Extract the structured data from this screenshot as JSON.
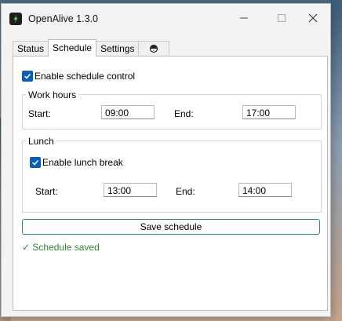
{
  "window": {
    "title": "OpenAlive 1.3.0",
    "controls": [
      "minimize",
      "maximize",
      "close"
    ]
  },
  "tabs": [
    {
      "label": "Status",
      "active": false
    },
    {
      "label": "Schedule",
      "active": true
    },
    {
      "label": "Settings",
      "active": false
    },
    {
      "icon": "palette-icon",
      "active": false
    }
  ],
  "schedule": {
    "enable_label": "Enable schedule control",
    "enabled": true,
    "work_hours": {
      "title": "Work hours",
      "start_label": "Start:",
      "start_value": "09:00",
      "end_label": "End:",
      "end_value": "17:00"
    },
    "lunch": {
      "title": "Lunch",
      "enable_label": "Enable lunch break",
      "enabled": true,
      "start_label": "Start:",
      "start_value": "13:00",
      "end_label": "End:",
      "end_value": "14:00"
    },
    "save_label": "Save schedule",
    "status_text": "✓ Schedule saved"
  },
  "colors": {
    "accent": "#0a5fb4",
    "success": "#2d8a2d",
    "button_border": "#2a8b8b"
  }
}
